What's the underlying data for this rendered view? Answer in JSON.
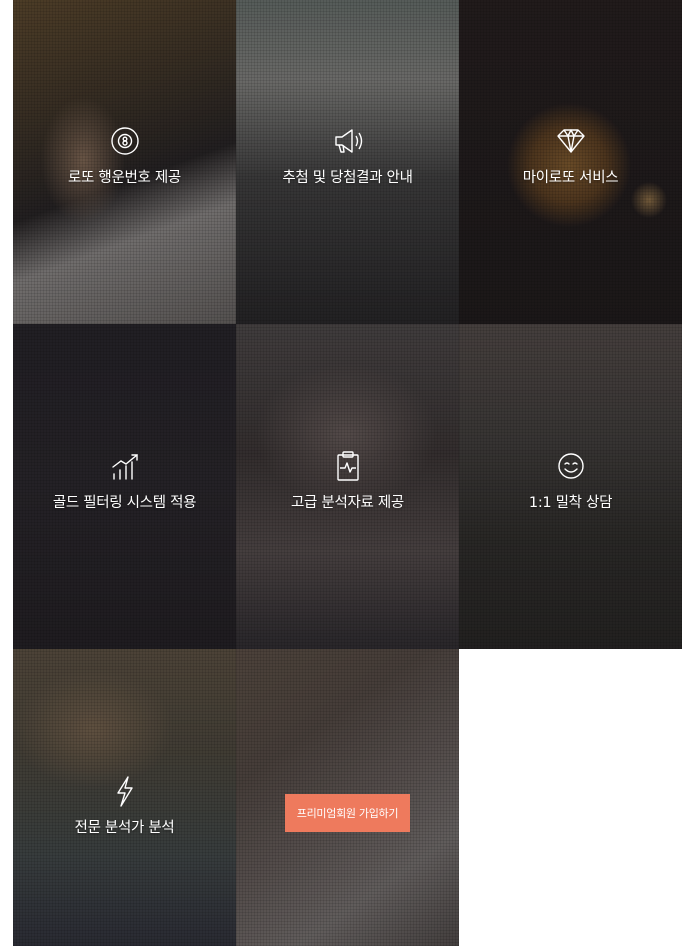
{
  "services": [
    {
      "label": "로또 행운번호 제공",
      "icon": "lucky-ball-icon"
    },
    {
      "label": "추첨 및 당첨결과 안내",
      "icon": "megaphone-icon"
    },
    {
      "label": "마이로또 서비스",
      "icon": "diamond-icon"
    },
    {
      "label": "골드 필터링 시스템 적용",
      "icon": "bar-chart-icon"
    },
    {
      "label": "고급 분석자료 제공",
      "icon": "clipboard-pulse-icon"
    },
    {
      "label": "1:1 밀착 상담",
      "icon": "smile-icon"
    },
    {
      "label": "전문 분석가 분석",
      "icon": "lightning-icon"
    }
  ],
  "premium": {
    "button_label": "프리미엄회원 가입하기"
  },
  "colors": {
    "accent": "#ee7a5d",
    "overlay": "#191618",
    "text": "#ffffff"
  }
}
